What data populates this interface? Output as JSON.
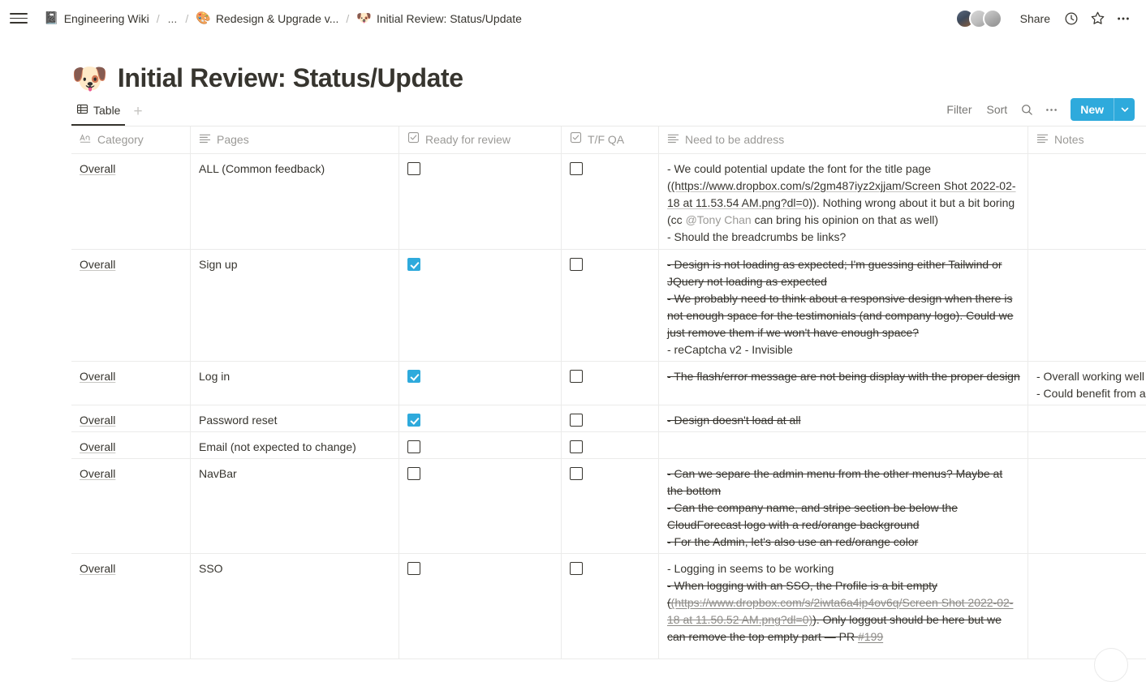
{
  "topbar": {
    "menu_icon": "hamburger-icon",
    "breadcrumb": [
      {
        "emoji": "📓",
        "label": "Engineering Wiki"
      },
      {
        "emoji": "",
        "label": "..."
      },
      {
        "emoji": "🎨",
        "label": "Redesign & Upgrade v..."
      },
      {
        "emoji": "🐶",
        "label": "Initial Review: Status/Update"
      }
    ],
    "separator": "/",
    "share_label": "Share",
    "history_icon": "clock-icon",
    "favorite_icon": "star-icon",
    "more_icon": "more-horizontal-icon",
    "avatar_count": 3
  },
  "page": {
    "emoji": "🐶",
    "title": "Initial Review: Status/Update"
  },
  "view": {
    "tab_label": "Table",
    "tab_icon": "table-icon",
    "add_view_label": "+",
    "filter_label": "Filter",
    "sort_label": "Sort",
    "search_icon": "search-icon",
    "more_icon": "more-horizontal-icon",
    "new_label": "New",
    "new_dropdown_icon": "chevron-down-icon",
    "accent_color": "#2eaadc"
  },
  "table": {
    "columns": [
      {
        "label": "Category",
        "icon": "text-aa-icon"
      },
      {
        "label": "Pages",
        "icon": "multiline-text-icon"
      },
      {
        "label": "Ready for review",
        "icon": "checkbox-icon"
      },
      {
        "label": "T/F QA",
        "icon": "checkbox-icon"
      },
      {
        "label": "Need to be address",
        "icon": "multiline-text-icon"
      },
      {
        "label": "Notes",
        "icon": "multiline-text-icon"
      }
    ],
    "rows": [
      {
        "category": "Overall",
        "pages": "ALL (Common feedback)",
        "ready_for_review": false,
        "tf_qa": false,
        "need_lines": [
          "- We could potential update the font for the title page",
          "(https://www.dropbox.com/s/2gm487iyz2xjjam/Screen Shot 2022-02-18 at 11.53.54 AM.png?dl=0)",
          "). Nothing wrong about it but a bit boring (cc ",
          "@Tony Chan",
          " can bring his opinion on that as well)",
          "- Should the breadcrumbs be links?"
        ],
        "notes": ""
      },
      {
        "category": "Overall",
        "pages": "Sign up",
        "ready_for_review": true,
        "tf_qa": false,
        "need_lines": [
          "- Design is not loading as expected; I'm guessing either Tailwind or JQuery not loading as expected",
          "- We probably need to think about a responsive design when there is not enough space for the testimonials (and company logo). Could we just remove them if we won't have enough space?",
          "- reCaptcha v2 - Invisible"
        ],
        "notes": ""
      },
      {
        "category": "Overall",
        "pages": "Log in",
        "ready_for_review": true,
        "tf_qa": false,
        "need_lines": [
          "- The flash/error message are not being display with the proper design"
        ],
        "notes_lines": [
          "- Overall working well",
          "- Could benefit from a"
        ]
      },
      {
        "category": "Overall",
        "pages": "Password reset",
        "ready_for_review": true,
        "tf_qa": false,
        "need_lines": [
          "- Design doesn't load at all"
        ],
        "notes": ""
      },
      {
        "category": "Overall",
        "pages": "Email (not expected to change)",
        "ready_for_review": false,
        "tf_qa": false,
        "need_lines": [],
        "notes": ""
      },
      {
        "category": "Overall",
        "pages": "NavBar",
        "ready_for_review": false,
        "tf_qa": false,
        "need_lines": [
          "- Can we separe the admin menu from the other menus? Maybe at the bottom",
          "- Can the company name, and stripe section  be below the CloudForecast logo with a red/orange background",
          "- For the Admin, let's also use an red/orange color"
        ],
        "notes": ""
      },
      {
        "category": "Overall",
        "pages": "SSO",
        "ready_for_review": false,
        "tf_qa": false,
        "need_lines": [
          "- Logging in seems to be working",
          "- When logging with an SSO, the Profile is a bit empty",
          "(https://www.dropbox.com/s/2iwta6a4ip4ov6q/Screen Shot 2022-02-18 at 11.50.52 AM.png?dl=0)",
          "). Only loggout should be here but we can remove the top empty part  —  PR ",
          "#199"
        ],
        "notes": ""
      }
    ]
  }
}
